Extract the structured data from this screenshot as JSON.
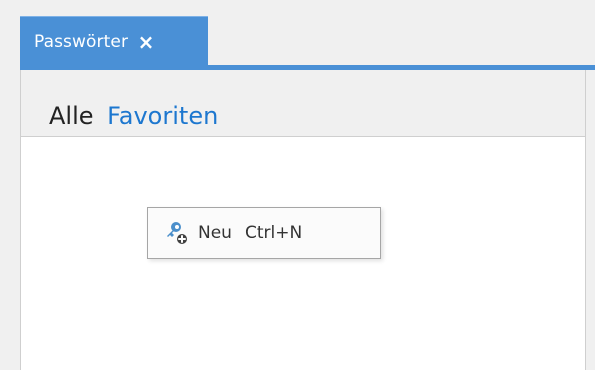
{
  "tab": {
    "label": "Passwörter",
    "close_symbol": "×"
  },
  "header": {
    "all_label": "Alle",
    "favorites_label": "Favoriten"
  },
  "context_menu": {
    "items": [
      {
        "label": "Neu",
        "shortcut": "Ctrl+N",
        "icon": "key-add-icon"
      }
    ]
  },
  "colors": {
    "accent": "#4a90d6",
    "favorites_text": "#1d77cf",
    "background": "#f0f0f0",
    "content_background": "#ffffff"
  }
}
